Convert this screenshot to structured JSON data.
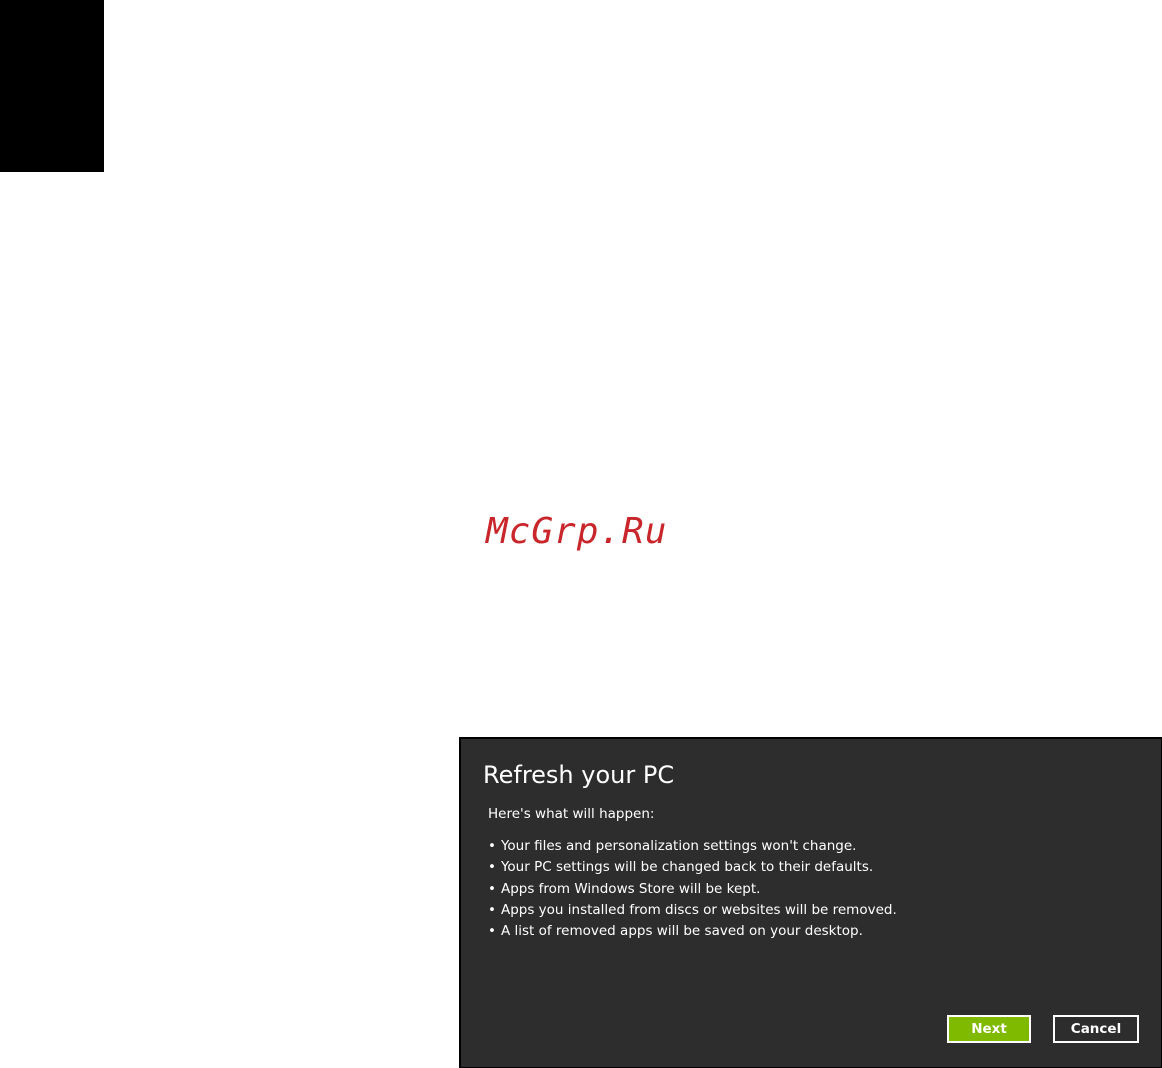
{
  "watermark": {
    "text": "McGrp.Ru"
  },
  "dialog": {
    "title": "Refresh your PC",
    "intro": "Here's what will happen:",
    "bullets": [
      "Your files and personalization settings won't change.",
      "Your PC settings will be changed back to their defaults.",
      "Apps from Windows Store will be kept.",
      "Apps you installed from discs or websites will be removed.",
      "A list of removed apps will be saved on your desktop."
    ],
    "bullet_glyph": "•",
    "buttons": {
      "next_label": "Next",
      "cancel_label": "Cancel"
    }
  },
  "colors": {
    "dialog_background": "#2d2d2d",
    "accent_green": "#7fb900",
    "watermark_red": "#c8262b"
  }
}
